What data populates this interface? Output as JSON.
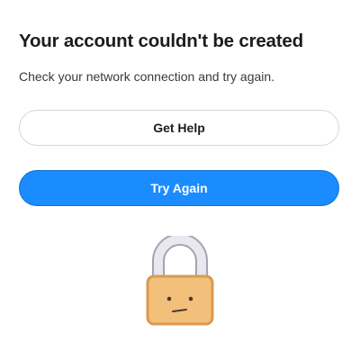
{
  "dialog": {
    "title": "Your account couldn't be created",
    "message": "Check your network connection and try again."
  },
  "buttons": {
    "get_help_label": "Get Help",
    "try_again_label": "Try Again"
  },
  "illustration": {
    "icon": "sad-lock-icon"
  },
  "colors": {
    "primary_button": "#1a8cff",
    "lock_body": "#f3c07c",
    "lock_shackle": "#e6e6ec"
  }
}
